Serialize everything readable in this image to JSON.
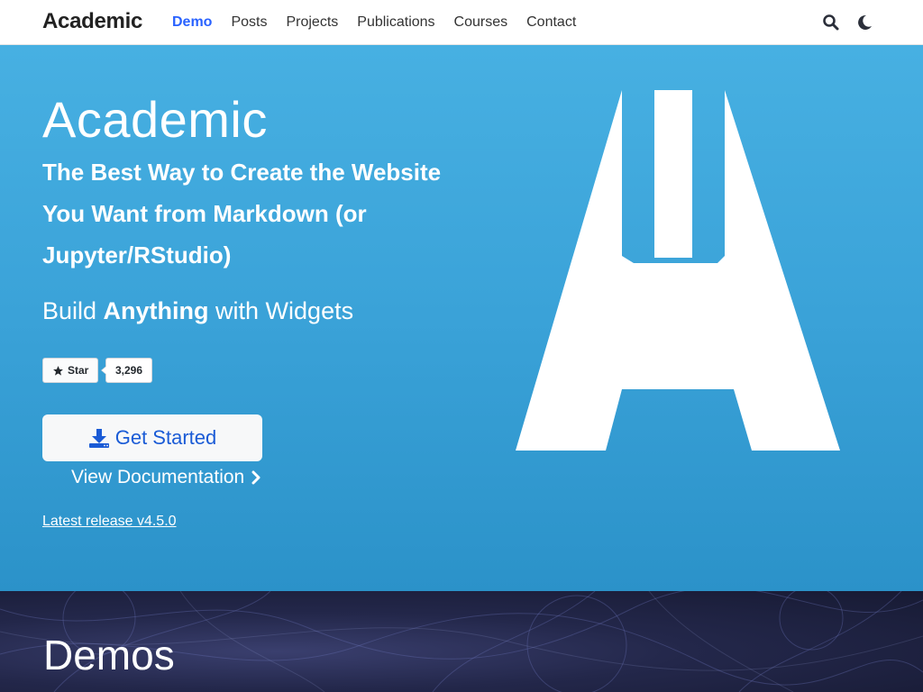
{
  "navbar": {
    "brand": "Academic",
    "links": [
      "Demo",
      "Posts",
      "Projects",
      "Publications",
      "Courses",
      "Contact"
    ],
    "active_link": "Demo",
    "icons": [
      "search-icon",
      "moon-icon"
    ]
  },
  "hero": {
    "title": "Academic",
    "lead": "The Best Way to Create the Website You Want from Markdown (or Jupyter/RStudio)",
    "sub_prefix": "Build ",
    "sub_bold": "Anything",
    "sub_suffix": " with Widgets",
    "github_star_label": "Star",
    "github_star_count": "3,296",
    "get_started_label": "Get Started",
    "view_docs_label": "View Documentation",
    "latest_release": "Latest release v4.5.0"
  },
  "demos": {
    "title": "Demos"
  },
  "colors": {
    "hero_bg": "#3aa2d8",
    "accent": "#2962ff",
    "demos_bg": "#23274a"
  }
}
